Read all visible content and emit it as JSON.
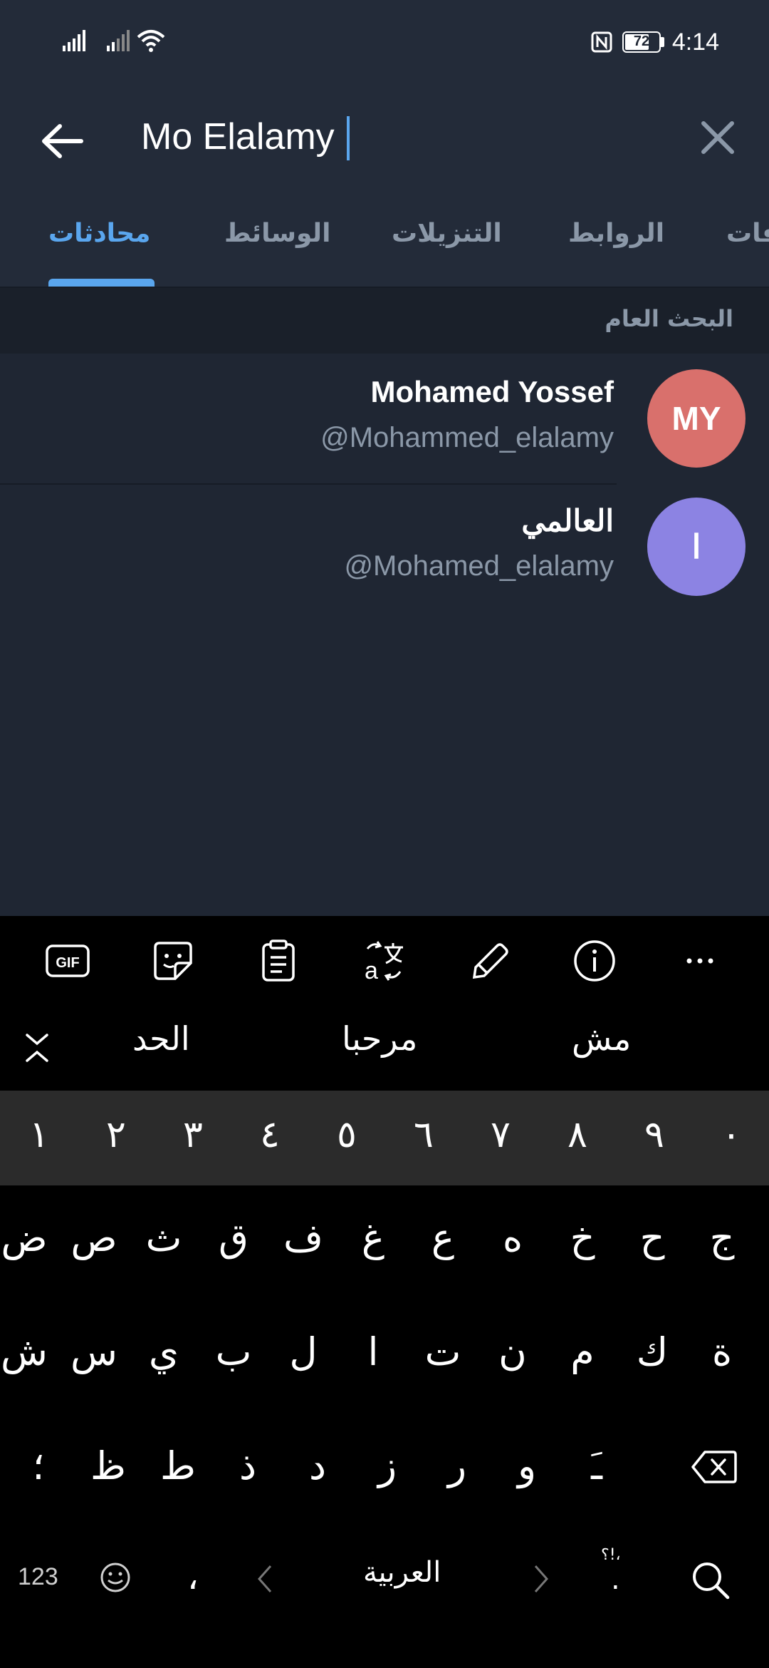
{
  "status_bar": {
    "time": "4:14",
    "battery_level": "72",
    "icons": [
      "signal-icon",
      "signal-icon",
      "wifi-icon",
      "nfc-icon",
      "battery-icon"
    ]
  },
  "search": {
    "query": "Mo Elalamy",
    "back_icon": "arrow-left-icon",
    "clear_icon": "close-icon"
  },
  "tabs": [
    {
      "label": "محادثات",
      "active": true
    },
    {
      "label": "الوسائط",
      "active": false
    },
    {
      "label": "التنزيلات",
      "active": false
    },
    {
      "label": "الروابط",
      "active": false
    },
    {
      "label": "فات",
      "active": false
    }
  ],
  "section": {
    "title": "البحث العام"
  },
  "results": [
    {
      "name": "Mohamed Yossef",
      "username": "@Mohammed_elalamy",
      "avatar_initials": "MY",
      "avatar_color": "#d9706c"
    },
    {
      "name": "العالمي",
      "username": "@Mohamed_elalamy",
      "avatar_initials": "ا",
      "avatar_color": "#8c83e3"
    }
  ],
  "keyboard": {
    "toolbar": {
      "gif_label": "GIF",
      "icons": [
        "gif-icon",
        "sticker-icon",
        "clipboard-icon",
        "translate-icon",
        "handwriting-icon",
        "info-icon",
        "more-icon"
      ],
      "more_label": "..."
    },
    "suggestions": [
      "الحد",
      "مرحبا",
      "مش"
    ],
    "number_row": [
      "١",
      "٢",
      "٣",
      "٤",
      "٥",
      "٦",
      "٧",
      "٨",
      "٩",
      "٠"
    ],
    "row1": [
      "ض",
      "ص",
      "ث",
      "ق",
      "ف",
      "غ",
      "ع",
      "ه",
      "خ",
      "ح",
      "ج"
    ],
    "row2": [
      "ش",
      "س",
      "ي",
      "ب",
      "ل",
      "ا",
      "ت",
      "ن",
      "م",
      "ك",
      "ة"
    ],
    "row3": [
      "؛",
      "ظ",
      "ط",
      "ذ",
      "د",
      "ز",
      "ر",
      "و",
      "ـَ"
    ],
    "bottom": {
      "numbers_label": "123",
      "comma": "،",
      "language_label": "العربية",
      "punct_label": "؟!،",
      "period": "."
    }
  },
  "colors": {
    "accent": "#5aa6ee",
    "background": "#1f2633",
    "header": "#232b39",
    "secondary_text": "#8b98a8"
  }
}
